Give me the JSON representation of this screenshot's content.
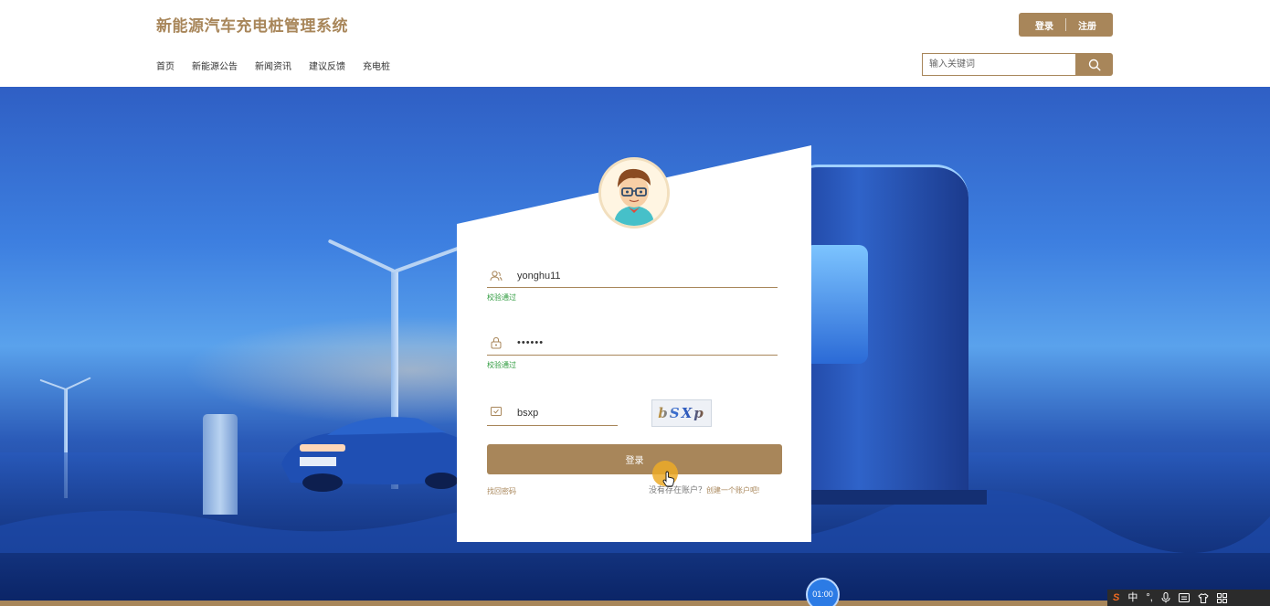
{
  "header": {
    "site_title": "新能源汽车充电桩管理系统",
    "login_label": "登录",
    "register_label": "注册",
    "nav": [
      "首页",
      "新能源公告",
      "新闻资讯",
      "建议反馈",
      "充电桩"
    ],
    "search_placeholder": "输入关键词"
  },
  "login_form": {
    "username": "yonghu11",
    "username_status": "校验通过",
    "password_masked": "••••••",
    "password_status": "校验通过",
    "captcha_input": "bsxp",
    "captcha_image_text": "bSXp",
    "submit_label": "登录",
    "forgot_password": "找回密码",
    "no_account_text": "没有存在账户？",
    "create_account": "创建一个账户吧!"
  },
  "overlay": {
    "timer": "01:00"
  },
  "system_tray": {
    "ime_mode": "中",
    "icons": [
      "sogou-ime-icon",
      "punctuation-icon",
      "microphone-icon",
      "keyboard-icon",
      "skin-icon",
      "toolbox-icon"
    ]
  },
  "colors": {
    "accent": "#a8865a",
    "valid": "#2e9b3e",
    "timer": "#2c7be5"
  }
}
